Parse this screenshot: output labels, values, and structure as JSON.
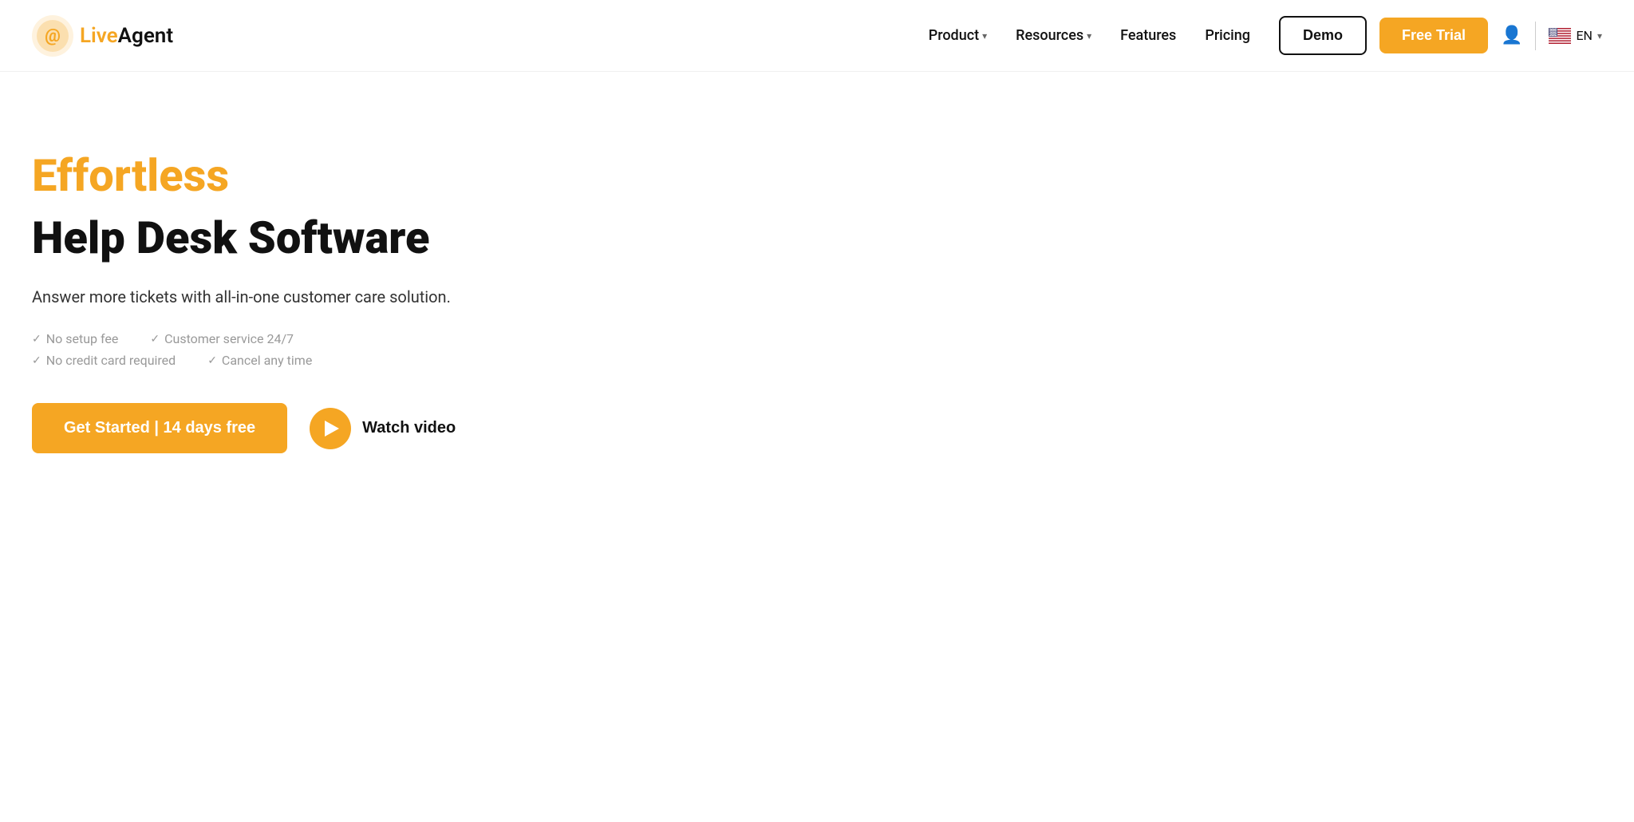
{
  "brand": {
    "name_live": "Live",
    "name_agent": "Agent",
    "logo_alt": "LiveAgent logo"
  },
  "nav": {
    "links": [
      {
        "label": "Product",
        "has_dropdown": true
      },
      {
        "label": "Resources",
        "has_dropdown": true
      },
      {
        "label": "Features",
        "has_dropdown": false
      },
      {
        "label": "Pricing",
        "has_dropdown": false
      }
    ],
    "demo_label": "Demo",
    "free_trial_label": "Free Trial",
    "lang_code": "EN"
  },
  "hero": {
    "tagline": "Effortless",
    "title": "Help Desk Software",
    "subtitle": "Answer more tickets with all-in-one customer care solution.",
    "checks": [
      {
        "text": "No setup fee"
      },
      {
        "text": "Customer service 24/7"
      },
      {
        "text": "No credit card required"
      },
      {
        "text": "Cancel any time"
      }
    ],
    "cta_label": "Get Started | 14 days free",
    "watch_video_label": "Watch video"
  }
}
